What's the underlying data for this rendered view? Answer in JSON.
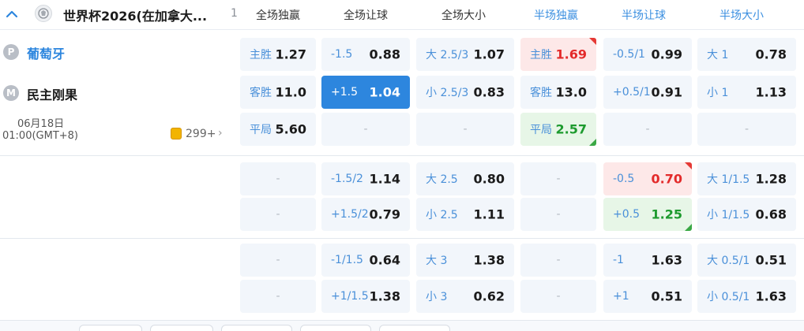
{
  "header": {
    "league": "世界杯2026(在加拿大...",
    "match_count": "1",
    "columns": [
      "全场独赢",
      "全场让球",
      "全场大小",
      "半场独赢",
      "半场让球",
      "半场大小"
    ]
  },
  "match": {
    "home": {
      "badge": "P",
      "name": "葡萄牙"
    },
    "away": {
      "badge": "M",
      "name": "民主刚果"
    },
    "date": "06月18日",
    "time": "01:00(GMT+8)",
    "more_count": "299+",
    "more_arrow": "›"
  },
  "dash": "-",
  "markets": [
    {
      "rows": [
        [
          {
            "label": "主胜",
            "value": "1.27"
          },
          {
            "label": "-1.5",
            "value": "0.88"
          },
          {
            "label": "大 2.5/3",
            "value": "1.07"
          },
          {
            "label": "主胜",
            "value": "1.69",
            "state": "up"
          },
          {
            "label": "-0.5/1",
            "value": "0.99"
          },
          {
            "label": "大 1",
            "value": "0.78"
          }
        ],
        [
          {
            "label": "客胜",
            "value": "11.0"
          },
          {
            "label": "+1.5",
            "value": "1.04",
            "state": "selected"
          },
          {
            "label": "小 2.5/3",
            "value": "0.83"
          },
          {
            "label": "客胜",
            "value": "13.0"
          },
          {
            "label": "+0.5/1",
            "value": "0.91"
          },
          {
            "label": "小 1",
            "value": "1.13"
          }
        ],
        [
          {
            "label": "平局",
            "value": "5.60"
          },
          {
            "empty": true
          },
          {
            "empty": true
          },
          {
            "label": "平局",
            "value": "2.57",
            "state": "down"
          },
          {
            "empty": true
          },
          {
            "empty": true
          }
        ]
      ]
    },
    {
      "rows": [
        [
          {
            "empty": true
          },
          {
            "label": "-1.5/2",
            "value": "1.14"
          },
          {
            "label": "大 2.5",
            "value": "0.80"
          },
          {
            "empty": true
          },
          {
            "label": "-0.5",
            "value": "0.70",
            "state": "up"
          },
          {
            "label": "大 1/1.5",
            "value": "1.28"
          }
        ],
        [
          {
            "empty": true
          },
          {
            "label": "+1.5/2",
            "value": "0.79"
          },
          {
            "label": "小 2.5",
            "value": "1.11"
          },
          {
            "empty": true
          },
          {
            "label": "+0.5",
            "value": "1.25",
            "state": "down"
          },
          {
            "label": "小 1/1.5",
            "value": "0.68"
          }
        ]
      ]
    },
    {
      "rows": [
        [
          {
            "empty": true
          },
          {
            "label": "-1/1.5",
            "value": "0.64"
          },
          {
            "label": "大 3",
            "value": "1.38"
          },
          {
            "empty": true
          },
          {
            "label": "-1",
            "value": "1.63"
          },
          {
            "label": "大 0.5/1",
            "value": "0.51"
          }
        ],
        [
          {
            "empty": true
          },
          {
            "label": "+1/1.5",
            "value": "1.38"
          },
          {
            "label": "小 3",
            "value": "0.62"
          },
          {
            "empty": true
          },
          {
            "label": "+1",
            "value": "0.51"
          },
          {
            "label": "小 0.5/1",
            "value": "1.63"
          }
        ]
      ]
    }
  ],
  "colors": {
    "accent": "#2d86de",
    "cell_bg": "#f2f6fb",
    "up": "#e32a2a",
    "down": "#1d9a2e"
  }
}
